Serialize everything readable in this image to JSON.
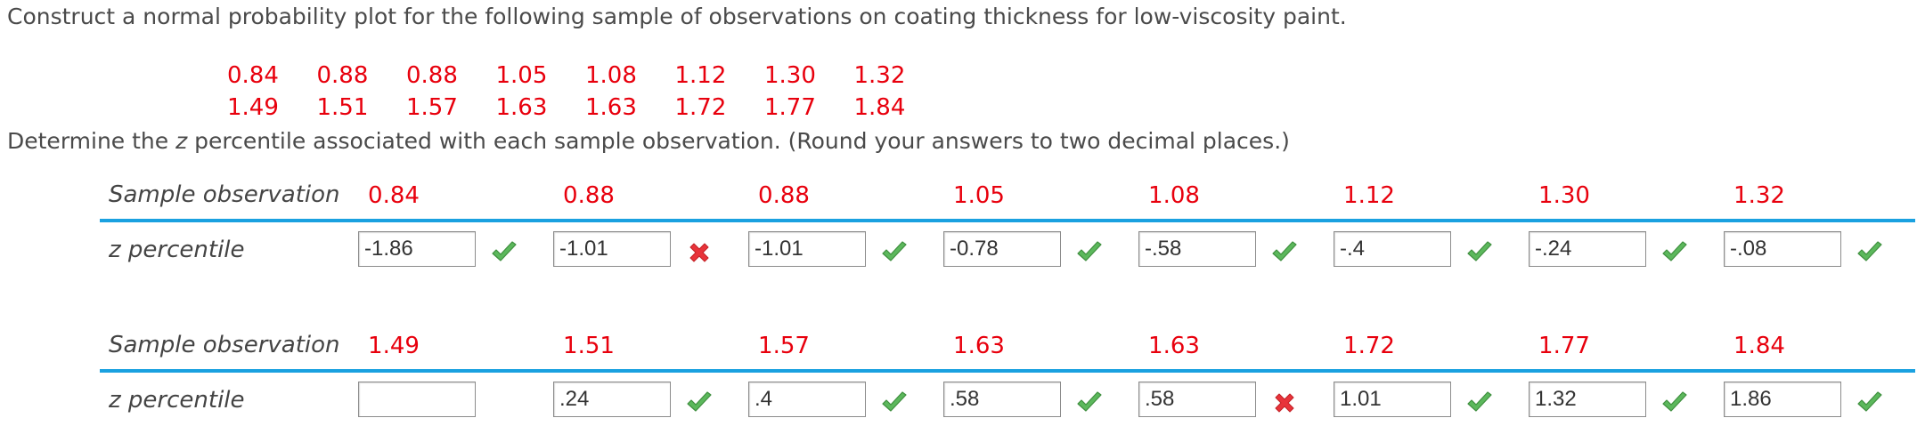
{
  "intro": "Construct a normal probability plot for the following sample of observations on coating thickness for low-viscosity paint.",
  "dataset": {
    "row1": [
      "0.84",
      "0.88",
      "0.88",
      "1.05",
      "1.08",
      "1.12",
      "1.30",
      "1.32"
    ],
    "row2": [
      "1.49",
      "1.51",
      "1.57",
      "1.63",
      "1.63",
      "1.72",
      "1.77",
      "1.84"
    ]
  },
  "instruction": {
    "before": "Determine the ",
    "var": "z",
    "after": " percentile associated with each sample observation. (Round your answers to two decimal places.)"
  },
  "tables": [
    {
      "obs_label": "Sample observation",
      "z_label": "z percentile",
      "observations": [
        "0.84",
        "0.88",
        "0.88",
        "1.05",
        "1.08",
        "1.12",
        "1.30",
        "1.32"
      ],
      "answers": [
        "-1.86",
        "-1.01",
        "-1.01",
        "-0.78",
        "-.58",
        "-.4",
        "-.24",
        "-.08"
      ],
      "status": [
        "correct",
        "incorrect",
        "correct",
        "correct",
        "correct",
        "correct",
        "correct",
        "correct"
      ]
    },
    {
      "obs_label": "Sample observation",
      "z_label": "z percentile",
      "observations": [
        "1.49",
        "1.51",
        "1.57",
        "1.63",
        "1.63",
        "1.72",
        "1.77",
        "1.84"
      ],
      "answers": [
        "",
        ".24",
        ".4",
        ".58",
        ".58",
        "1.01",
        "1.32",
        "1.86"
      ],
      "status": [
        "none",
        "correct",
        "correct",
        "correct",
        "incorrect",
        "correct",
        "correct",
        "correct"
      ]
    }
  ],
  "icons": {
    "correct": "check-icon",
    "incorrect": "cross-icon"
  },
  "colors": {
    "value_red": "#e8000d",
    "rule_blue": "#1aa1e0",
    "check_green": "#5cb85c",
    "cross_red": "#e8333a"
  }
}
